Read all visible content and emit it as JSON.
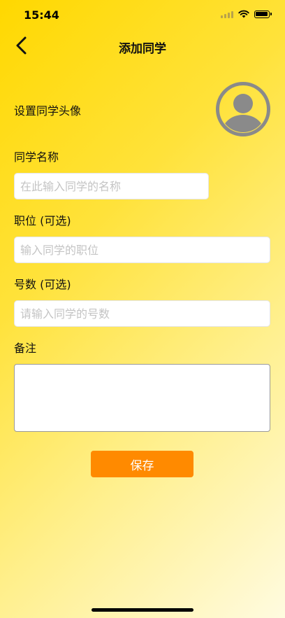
{
  "status_bar": {
    "time": "15:44"
  },
  "nav": {
    "title": "添加同学",
    "back_icon": "chevron-left-icon"
  },
  "avatar": {
    "label": "设置同学头像",
    "icon": "user-avatar-icon",
    "icon_color": "#8a8a8a"
  },
  "form": {
    "name": {
      "label": "同学名称",
      "value": "",
      "placeholder": "在此输入同学的名称"
    },
    "position": {
      "label": "职位 (可选)",
      "value": "",
      "placeholder": "输入同学的职位"
    },
    "number": {
      "label": "号数 (可选)",
      "value": "",
      "placeholder": "请输入同学的号数"
    },
    "notes": {
      "label": "备注",
      "value": ""
    }
  },
  "save_button": {
    "label": "保存",
    "color": "#ff8a00"
  },
  "colors": {
    "background_start": "#ffd800",
    "background_end": "#fffbe0"
  }
}
